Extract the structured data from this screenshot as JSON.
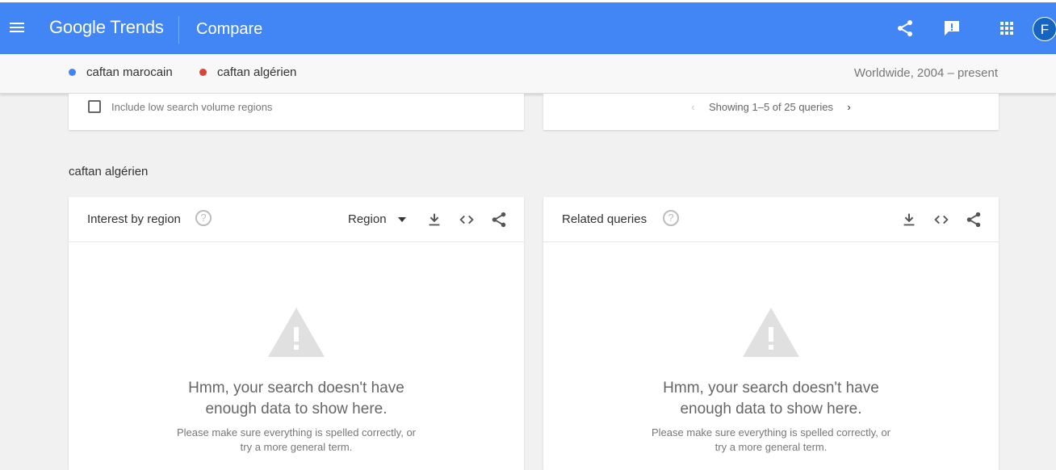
{
  "appbar": {
    "brand": "Google Trends",
    "page_title": "Compare",
    "avatar_letter": "F",
    "icons": [
      "menu-icon",
      "share-icon",
      "feedback-icon",
      "apps-icon"
    ],
    "color": "#4285f4"
  },
  "compare": {
    "terms": [
      {
        "label": "caftan marocain",
        "color": "#4285f4"
      },
      {
        "label": "caftan algérien",
        "color": "#db4437"
      }
    ],
    "range": "Worldwide, 2004 – present"
  },
  "upper_cards": {
    "include_low_volume_label": "Include low search volume regions",
    "include_low_volume_checked": false,
    "pager_text": "Showing 1–5 of 25 queries"
  },
  "section": {
    "title": "caftan algérien"
  },
  "panels": {
    "interest": {
      "title": "Interest by region",
      "help": "?",
      "select_value": "Region",
      "empty_title_line1": "Hmm, your search doesn't have",
      "empty_title_line2": "enough data to show here.",
      "empty_sub_line1": "Please make sure everything is spelled correctly, or",
      "empty_sub_line2": "try a more general term."
    },
    "related": {
      "title": "Related queries",
      "help": "?",
      "empty_title_line1": "Hmm, your search doesn't have",
      "empty_title_line2": "enough data to show here.",
      "empty_sub_line1": "Please make sure everything is spelled correctly, or",
      "empty_sub_line2": "try a more general term."
    }
  }
}
